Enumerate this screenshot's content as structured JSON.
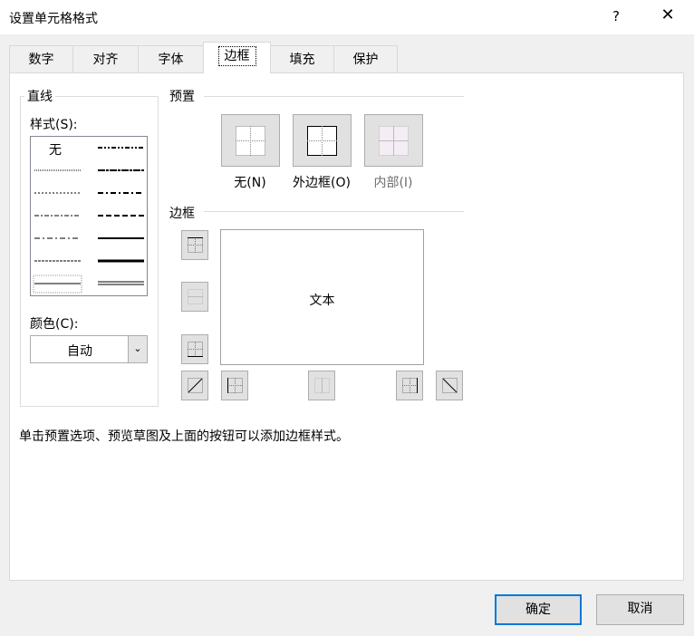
{
  "window": {
    "title": "设置单元格格式",
    "help": "?",
    "close": "✕"
  },
  "tabs": [
    {
      "label": "数字"
    },
    {
      "label": "对齐"
    },
    {
      "label": "字体"
    },
    {
      "label": "边框",
      "selected": true
    },
    {
      "label": "填充"
    },
    {
      "label": "保护"
    }
  ],
  "line": {
    "group_label": "直线",
    "style_label": "样式(S):",
    "none_label": "无",
    "color_label": "颜色(C):",
    "color_value": "自动"
  },
  "presets": {
    "group_label": "预置",
    "none": "无(N)",
    "outline": "外边框(O)",
    "inside": "内部(I)"
  },
  "border": {
    "group_label": "边框",
    "preview_text": "文本"
  },
  "hint": "单击预置选项、预览草图及上面的按钮可以添加边框样式。",
  "buttons": {
    "ok": "确定",
    "cancel": "取消"
  },
  "colors": {
    "accent": "#0078d7",
    "disabled": "#6d6d6d"
  }
}
